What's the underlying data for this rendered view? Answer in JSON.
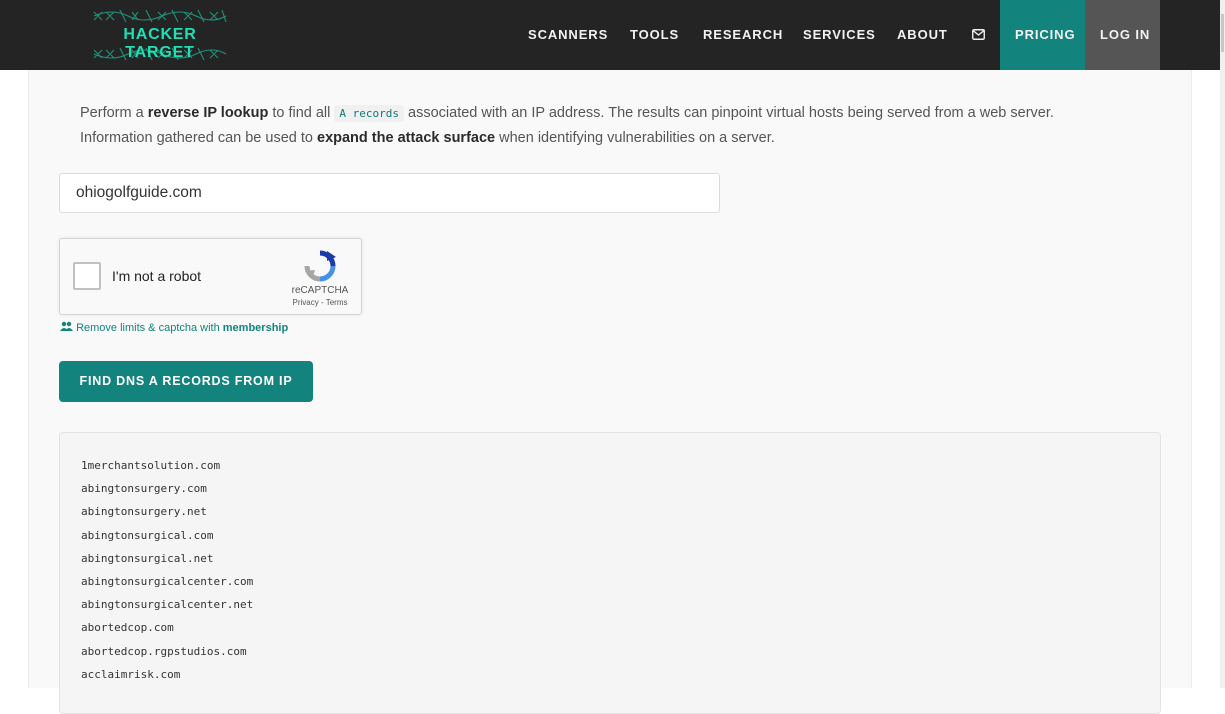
{
  "header": {
    "logo_text": "HACKER TARGET",
    "nav": {
      "scanners": "SCANNERS",
      "tools": "TOOLS",
      "research": "RESEARCH",
      "services": "SERVICES",
      "about": "ABOUT",
      "mail_icon": "envelope-icon",
      "pricing": "PRICING",
      "login": "LOG IN"
    }
  },
  "intro": {
    "part1": "Perform a ",
    "bold1": "reverse IP lookup",
    "part2": " to find all ",
    "code": "A records",
    "part3": " associated with an IP address. The results can pinpoint virtual hosts being served from a web server. Information gathered can be used to ",
    "bold2": "expand the attack surface",
    "part4": " when identifying vulnerabilities on a server."
  },
  "search": {
    "value": "ohiogolfguide.com"
  },
  "captcha": {
    "label": "I'm not a robot",
    "brand": "reCAPTCHA",
    "privacy": "Privacy",
    "separator": " - ",
    "terms": "Terms"
  },
  "membership": {
    "icon": "users-icon",
    "text": "Remove limits & captcha with ",
    "link": "membership"
  },
  "submit_button": "FIND DNS A RECORDS FROM IP",
  "results": [
    "1merchantsolution.com",
    "abingtonsurgery.com",
    "abingtonsurgery.net",
    "abingtonsurgical.com",
    "abingtonsurgical.net",
    "abingtonsurgicalcenter.com",
    "abingtonsurgicalcenter.net",
    "abortedcop.com",
    "abortedcop.rgpstudios.com",
    "acclaimrisk.com"
  ],
  "colors": {
    "teal": "#12847d",
    "logo_green": "#1ee0b5",
    "header_bg": "#242424",
    "login_bg": "#555555"
  }
}
